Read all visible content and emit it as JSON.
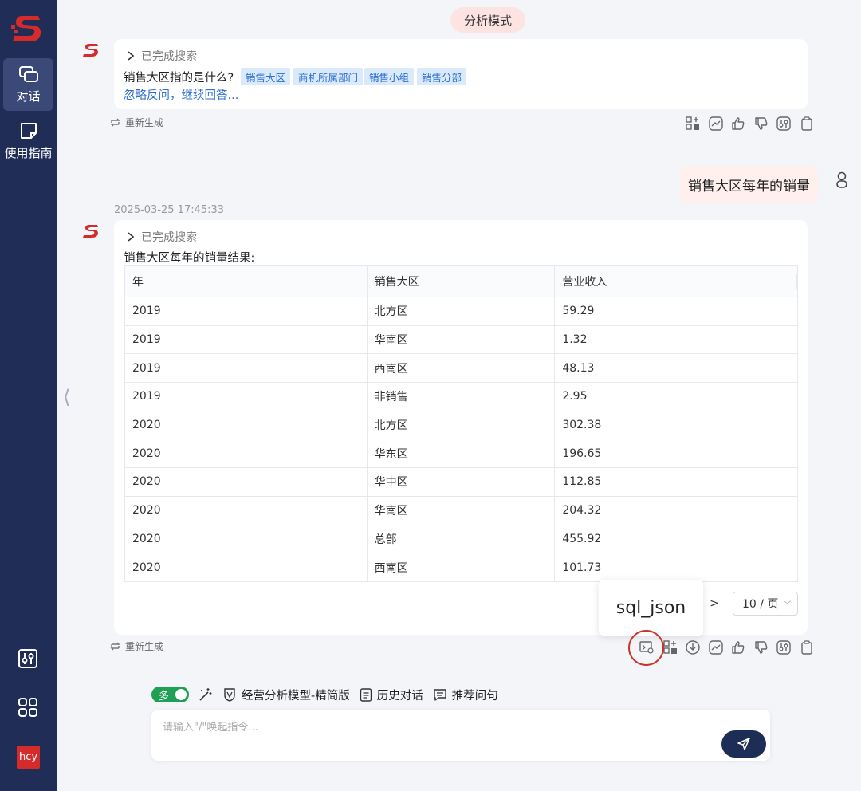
{
  "sidebar": {
    "items": [
      {
        "label": "对话"
      },
      {
        "label": "使用指南"
      }
    ],
    "user_initials": "hcy"
  },
  "mode_label": "分析模式",
  "message1": {
    "search_status": "已完成搜索",
    "question": "销售大区指的是什么?",
    "tags": [
      "销售大区",
      "商机所属部门",
      "销售小组",
      "销售分部"
    ],
    "ignore_link": "忽略反问，继续回答...",
    "regenerate": "重新生成"
  },
  "user_message": "销售大区每年的销量",
  "message2": {
    "timestamp": "2025-03-25 17:45:33",
    "search_status": "已完成搜索",
    "result_title": "销售大区每年的销量结果:",
    "columns": [
      "年",
      "销售大区",
      "营业收入"
    ],
    "rows": [
      [
        "2019",
        "北方区",
        "59.29"
      ],
      [
        "2019",
        "华南区",
        "1.32"
      ],
      [
        "2019",
        "西南区",
        "48.13"
      ],
      [
        "2019",
        "非销售",
        "2.95"
      ],
      [
        "2020",
        "北方区",
        "302.38"
      ],
      [
        "2020",
        "华东区",
        "196.65"
      ],
      [
        "2020",
        "华中区",
        "112.85"
      ],
      [
        "2020",
        "华南区",
        "204.32"
      ],
      [
        "2020",
        "总部",
        "455.92"
      ],
      [
        "2020",
        "西南区",
        "101.73"
      ]
    ],
    "page_next": ">",
    "page_size": "10 / 页",
    "tooltip": "sql_json",
    "regenerate": "重新生成"
  },
  "composer": {
    "toggle_label": "多",
    "model_label": "经营分析模型-精简版",
    "history_label": "历史对话",
    "recommend_label": "推荐问句",
    "placeholder": "请输入\"/\"唤起指令..."
  },
  "colors": {
    "sidebar_bg": "#1f2d57",
    "accent_blue": "#2f6fd2",
    "brand_red": "#d52b2b",
    "toggle_green": "#1fa055"
  }
}
